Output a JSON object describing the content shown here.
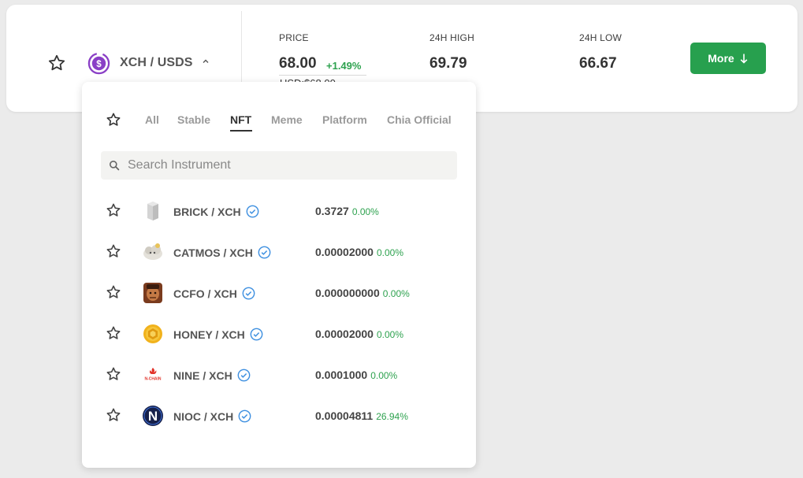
{
  "header": {
    "pair": "XCH / USDS",
    "stats": {
      "price_label": "PRICE",
      "price_value": "68.00",
      "price_change": "+1.49%",
      "usd_price": "USD:$68.00",
      "high_label": "24H HIGH",
      "high_value": "69.79",
      "low_label": "24H LOW",
      "low_value": "66.67"
    },
    "more_label": "More"
  },
  "colors": {
    "accent_green": "#27a04e",
    "change_green": "#2ea24f",
    "logo_purple": "#8a3fc6",
    "verified_blue": "#3d8fe0"
  },
  "dropdown": {
    "tabs": [
      {
        "label": "All",
        "active": false
      },
      {
        "label": "Stable",
        "active": false
      },
      {
        "label": "NFT",
        "active": true
      },
      {
        "label": "Meme",
        "active": false
      },
      {
        "label": "Platform",
        "active": false
      },
      {
        "label": "Chia Official",
        "active": false
      }
    ],
    "search": {
      "placeholder": "Search Instrument",
      "value": ""
    },
    "rows": [
      {
        "pair": "BRICK / XCH",
        "price": "0.3727",
        "change": "0.00%",
        "icon": "brick-icon"
      },
      {
        "pair": "CATMOS / XCH",
        "price": "0.00002000",
        "change": "0.00%",
        "icon": "catmos-icon"
      },
      {
        "pair": "CCFO / XCH",
        "price": "0.000000000",
        "change": "0.00%",
        "icon": "ccfo-icon"
      },
      {
        "pair": "HONEY / XCH",
        "price": "0.00002000",
        "change": "0.00%",
        "icon": "honey-icon"
      },
      {
        "pair": "NINE / XCH",
        "price": "0.0001000",
        "change": "0.00%",
        "icon": "nine-icon"
      },
      {
        "pair": "NIOC / XCH",
        "price": "0.00004811",
        "change": "26.94%",
        "icon": "nioc-icon"
      }
    ]
  }
}
